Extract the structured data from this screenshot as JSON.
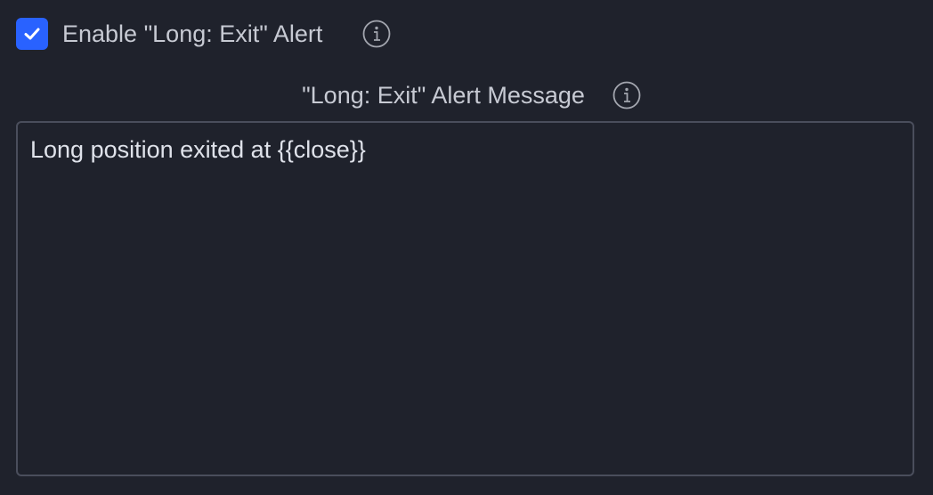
{
  "alert": {
    "enabled": true,
    "enable_label": "Enable \"Long: Exit\" Alert",
    "message_label": "\"Long: Exit\" Alert Message",
    "message_value": "Long position exited at {{close}}"
  },
  "icons": {
    "checkbox": "checkmark-icon",
    "info": "info-icon"
  },
  "colors": {
    "background": "#1f222c",
    "checkbox_accent": "#2962ff",
    "text": "#c7cad3",
    "border": "#4a4e5c"
  }
}
